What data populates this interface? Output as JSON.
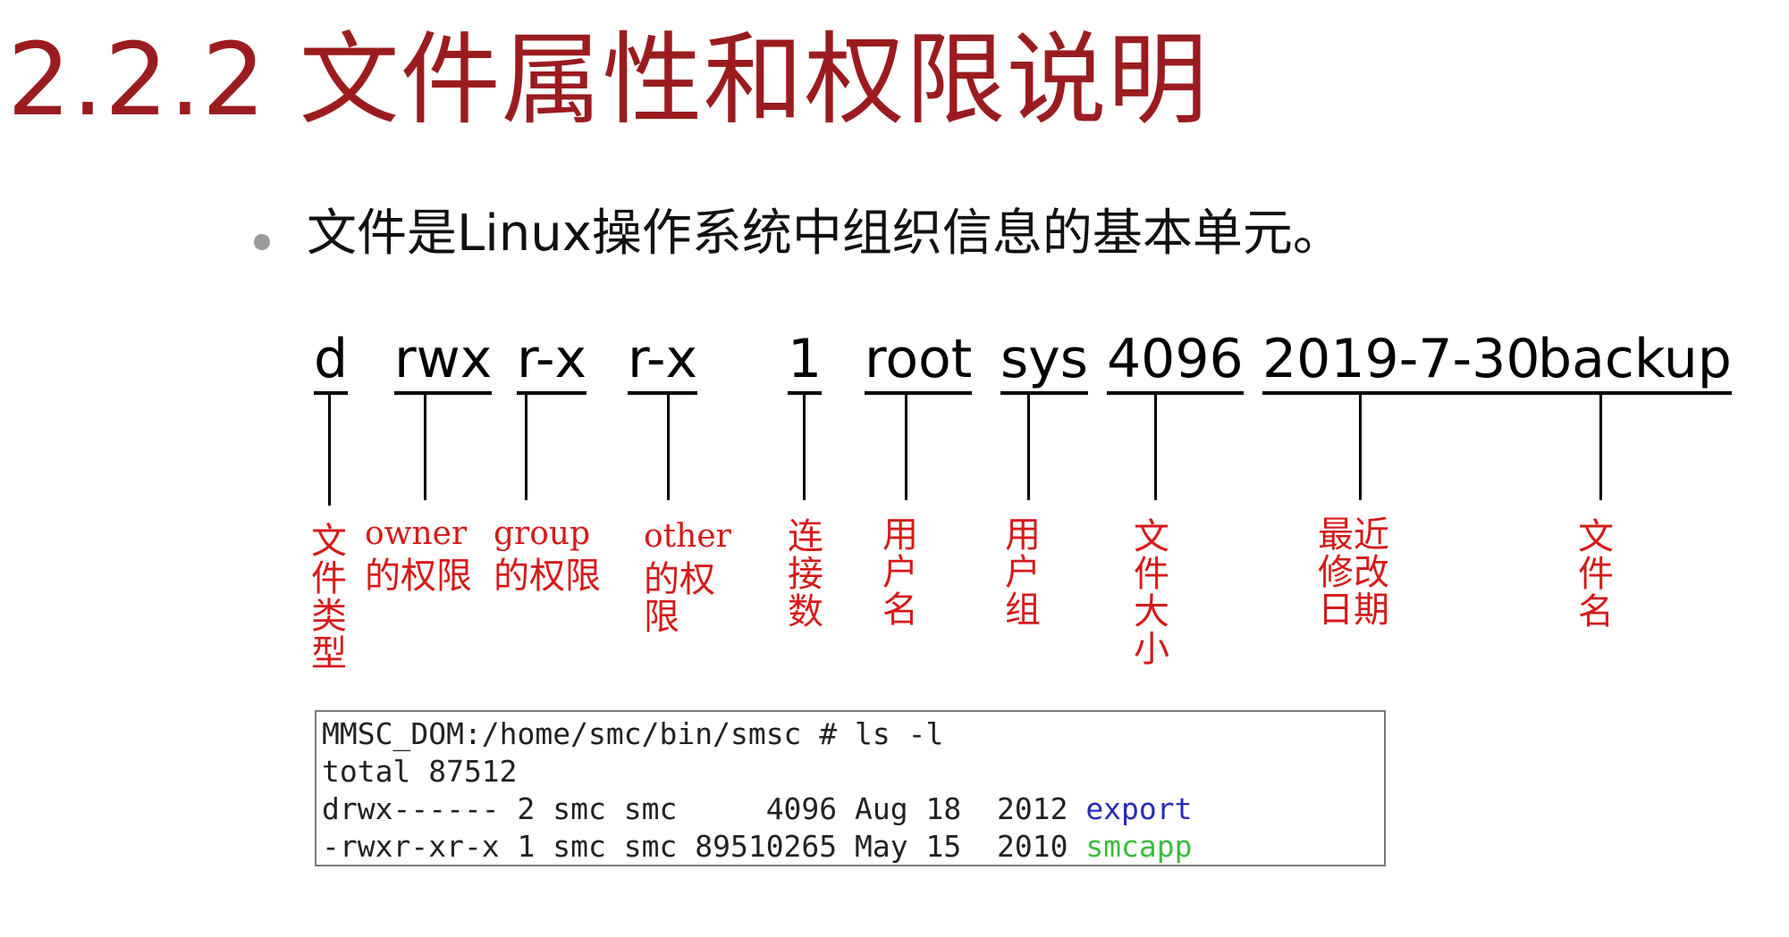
{
  "title": "2.2.2 文件属性和权限说明",
  "bullet": "文件是Linux操作系统中组织信息的基本单元。",
  "fields": [
    "d",
    "rwx",
    "r-x",
    "r-x",
    "1",
    "root",
    "sys",
    "4096",
    "2019-7-30",
    "backup"
  ],
  "labels": {
    "file_type": "文件类型",
    "owner_en": "owner",
    "owner_cn": "的权限",
    "group_en": "group",
    "group_cn": "的权限",
    "other_en": "other",
    "other_cn": "的权限",
    "link_count": "连接数",
    "user_name": "用户名",
    "user_group": "用户组",
    "file_size": "文件大小",
    "modified_date": "最近修改日期",
    "file_name": "文件名"
  },
  "terminal": {
    "prompt": "MMSC_DOM:/home/smc/bin/smsc # ls -l",
    "total": "total 87512",
    "rows": [
      {
        "prefix": "drwx------ 2 smc smc     4096 Aug 18  2012 ",
        "name": "export",
        "color": "#2a2ab8"
      },
      {
        "prefix": "-rwxr-xr-x 1 smc smc 89510265 May 15  2010 ",
        "name": "smcapp",
        "color": "#3cbc3c"
      }
    ]
  },
  "colors": {
    "title": "#9b1c1f",
    "label": "#d61a1a"
  }
}
